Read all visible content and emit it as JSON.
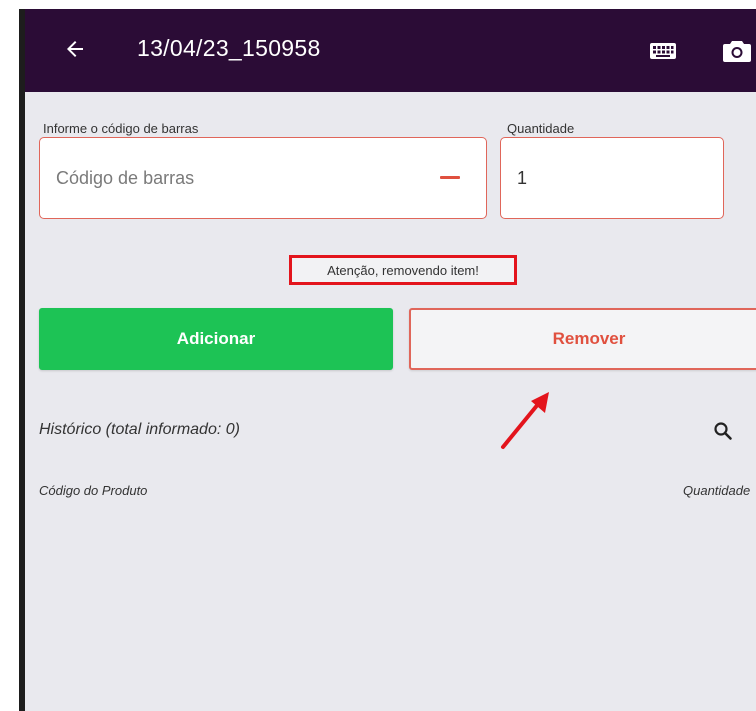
{
  "header": {
    "title": "13/04/23_150958"
  },
  "barcode": {
    "label": "Informe o código de barras",
    "placeholder": "Código de barras"
  },
  "quantity": {
    "label": "Quantidade",
    "value": "1"
  },
  "warning": "Atenção, removendo item!",
  "actions": {
    "add_label": "Adicionar",
    "remove_label": "Remover"
  },
  "history": {
    "title": "Histórico (total informado: 0)",
    "columns": [
      "Código do Produto",
      "Quantidade"
    ]
  },
  "icons": {
    "back": "arrow-left-icon",
    "keyboard": "keyboard-icon",
    "camera": "camera-icon",
    "search": "search-icon",
    "clear": "minus-icon",
    "annotation": "red-arrow-icon"
  },
  "colors": {
    "topbar": "#2b0c36",
    "add": "#1dc355",
    "remove": "#e0503f",
    "warning_border": "#e3141c",
    "background": "#e9e9ee"
  }
}
